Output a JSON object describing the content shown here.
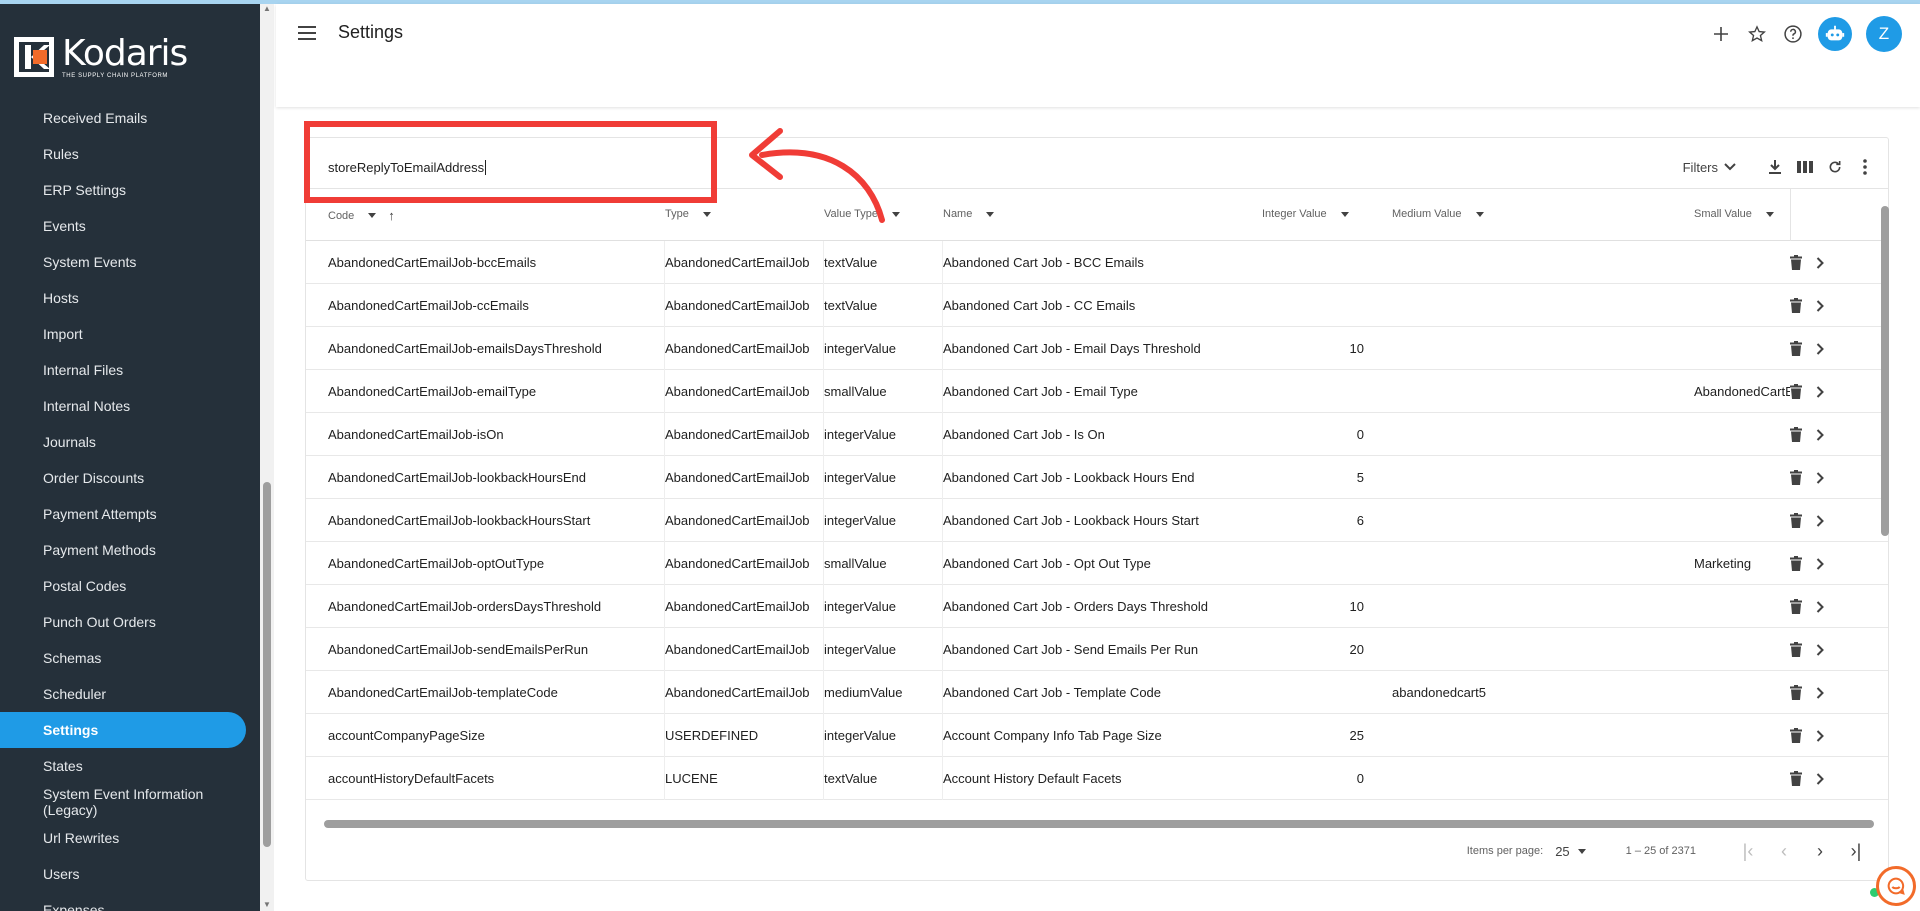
{
  "brand": {
    "name": "Kodaris",
    "tagline": "THE SUPPLY CHAIN PLATFORM",
    "accent": "#1f9be6",
    "logo_orange": "#f26b2a"
  },
  "header": {
    "title": "Settings",
    "avatar_initial": "Z"
  },
  "sidebar": {
    "items": [
      {
        "label": "Received Emails"
      },
      {
        "label": "Rules"
      },
      {
        "label": "ERP Settings"
      },
      {
        "label": "Events"
      },
      {
        "label": "System Events"
      },
      {
        "label": "Hosts"
      },
      {
        "label": "Import"
      },
      {
        "label": "Internal Files"
      },
      {
        "label": "Internal Notes"
      },
      {
        "label": "Journals"
      },
      {
        "label": "Order Discounts"
      },
      {
        "label": "Payment Attempts"
      },
      {
        "label": "Payment Methods"
      },
      {
        "label": "Postal Codes"
      },
      {
        "label": "Punch Out Orders"
      },
      {
        "label": "Schemas"
      },
      {
        "label": "Scheduler"
      },
      {
        "label": "Settings",
        "active": true
      },
      {
        "label": "States"
      },
      {
        "label": "System Event Information (Legacy)"
      },
      {
        "label": "Url Rewrites"
      },
      {
        "label": "Users"
      },
      {
        "label": "Expenses"
      }
    ]
  },
  "search": {
    "value": "storeReplyToEmailAddress"
  },
  "toolbar": {
    "filters_label": "Filters"
  },
  "table": {
    "columns": {
      "code": "Code",
      "type": "Type",
      "value_type": "Value Type",
      "name": "Name",
      "integer_value": "Integer Value",
      "medium_value": "Medium Value",
      "small_value": "Small Value"
    },
    "rows": [
      {
        "code": "AbandonedCartEmailJob-bccEmails",
        "type": "AbandonedCartEmailJob",
        "value_type": "textValue",
        "name": "Abandoned Cart Job - BCC Emails",
        "integer_value": "",
        "medium_value": "",
        "small_value": ""
      },
      {
        "code": "AbandonedCartEmailJob-ccEmails",
        "type": "AbandonedCartEmailJob",
        "value_type": "textValue",
        "name": "Abandoned Cart Job - CC Emails",
        "integer_value": "",
        "medium_value": "",
        "small_value": ""
      },
      {
        "code": "AbandonedCartEmailJob-emailsDaysThreshold",
        "type": "AbandonedCartEmailJob",
        "value_type": "integerValue",
        "name": "Abandoned Cart Job - Email Days Threshold",
        "integer_value": "10",
        "medium_value": "",
        "small_value": ""
      },
      {
        "code": "AbandonedCartEmailJob-emailType",
        "type": "AbandonedCartEmailJob",
        "value_type": "smallValue",
        "name": "Abandoned Cart Job - Email Type",
        "integer_value": "",
        "medium_value": "",
        "small_value": "AbandonedCartE"
      },
      {
        "code": "AbandonedCartEmailJob-isOn",
        "type": "AbandonedCartEmailJob",
        "value_type": "integerValue",
        "name": "Abandoned Cart Job - Is On",
        "integer_value": "0",
        "medium_value": "",
        "small_value": ""
      },
      {
        "code": "AbandonedCartEmailJob-lookbackHoursEnd",
        "type": "AbandonedCartEmailJob",
        "value_type": "integerValue",
        "name": "Abandoned Cart Job - Lookback Hours End",
        "integer_value": "5",
        "medium_value": "",
        "small_value": ""
      },
      {
        "code": "AbandonedCartEmailJob-lookbackHoursStart",
        "type": "AbandonedCartEmailJob",
        "value_type": "integerValue",
        "name": "Abandoned Cart Job - Lookback Hours Start",
        "integer_value": "6",
        "medium_value": "",
        "small_value": ""
      },
      {
        "code": "AbandonedCartEmailJob-optOutType",
        "type": "AbandonedCartEmailJob",
        "value_type": "smallValue",
        "name": "Abandoned Cart Job - Opt Out Type",
        "integer_value": "",
        "medium_value": "",
        "small_value": "Marketing"
      },
      {
        "code": "AbandonedCartEmailJob-ordersDaysThreshold",
        "type": "AbandonedCartEmailJob",
        "value_type": "integerValue",
        "name": "Abandoned Cart Job - Orders Days Threshold",
        "integer_value": "10",
        "medium_value": "",
        "small_value": ""
      },
      {
        "code": "AbandonedCartEmailJob-sendEmailsPerRun",
        "type": "AbandonedCartEmailJob",
        "value_type": "integerValue",
        "name": "Abandoned Cart Job - Send Emails Per Run",
        "integer_value": "20",
        "medium_value": "",
        "small_value": ""
      },
      {
        "code": "AbandonedCartEmailJob-templateCode",
        "type": "AbandonedCartEmailJob",
        "value_type": "mediumValue",
        "name": "Abandoned Cart Job - Template Code",
        "integer_value": "",
        "medium_value": "abandonedcart5",
        "small_value": ""
      },
      {
        "code": "accountCompanyPageSize",
        "type": "USERDEFINED",
        "value_type": "integerValue",
        "name": "Account Company Info Tab Page Size",
        "integer_value": "25",
        "medium_value": "",
        "small_value": ""
      },
      {
        "code": "accountHistoryDefaultFacets",
        "type": "LUCENE",
        "value_type": "textValue",
        "name": "Account History Default Facets",
        "integer_value": "0",
        "medium_value": "",
        "small_value": ""
      }
    ]
  },
  "pagination": {
    "items_per_page_label": "Items per page:",
    "items_per_page": "25",
    "range": "1 – 25 of 2371"
  },
  "annotation": {
    "box_color": "#f03c36"
  }
}
